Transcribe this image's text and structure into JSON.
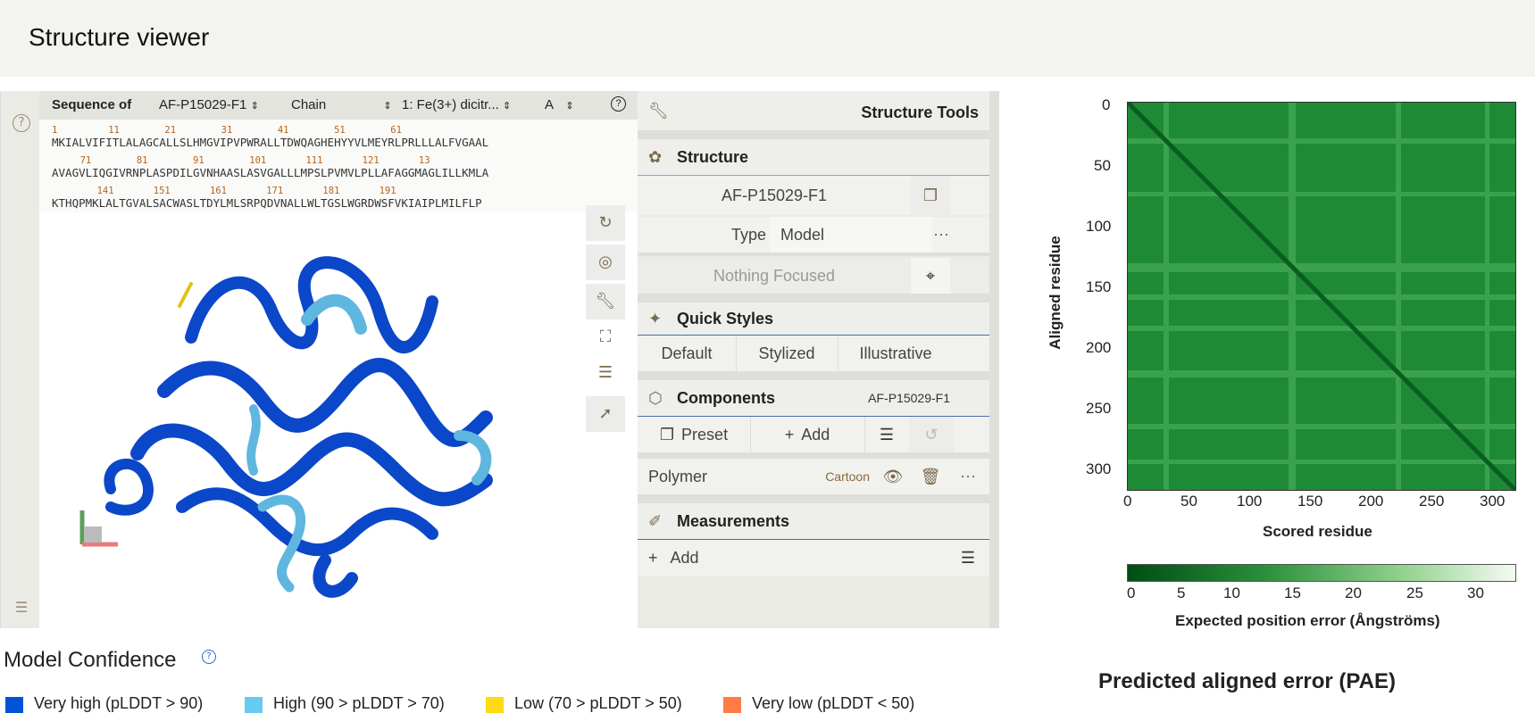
{
  "page": {
    "title": "Structure viewer"
  },
  "sequence": {
    "label": "Sequence of",
    "entry": "AF-P15029-F1",
    "mode": "Chain",
    "entity": "1: Fe(3+) dicitr...",
    "chain": "A",
    "rows": [
      {
        "numbers": "1         11        21        31        41        51        61",
        "seq": "MKIALVIFITLALAGCALLSLHMGVIPVPWRALLTDWQAGHEHYYVLMEYRLPRLLLALFVGAAL"
      },
      {
        "numbers": "     71        81        91        101       111       121       13",
        "seq": "AVAGVLIQGIVRNPLASPDILGVNHAASLASVGALLLMPSLPVMVLPLLAFAGGMAGLILLKMLA"
      },
      {
        "numbers": "        141       151       161       171       181       191",
        "seq": "KTHQPMKLALTGVALSACWASLTDYLMLSRPQDVNALLWLTGSLWGRDWSFVKIAIPLMILFLP"
      }
    ]
  },
  "tools": {
    "header": "Structure Tools",
    "structure": {
      "title": "Structure",
      "entry": "AF-P15029-F1",
      "type_label": "Type",
      "type_value": "Model",
      "focus": "Nothing Focused"
    },
    "quick_styles": {
      "title": "Quick Styles",
      "options": [
        "Default",
        "Stylized",
        "Illustrative"
      ]
    },
    "components": {
      "title": "Components",
      "entry": "AF-P15029-F1",
      "preset": "Preset",
      "add": "Add",
      "polymer": "Polymer",
      "representation": "Cartoon"
    },
    "measurements": {
      "title": "Measurements",
      "add": "Add"
    }
  },
  "pae": {
    "title": "Predicted aligned error (PAE)",
    "xlabel": "Scored residue",
    "ylabel": "Aligned residue",
    "x_ticks": [
      "0",
      "50",
      "100",
      "150",
      "200",
      "250",
      "300"
    ],
    "y_ticks": [
      "0",
      "50",
      "100",
      "150",
      "200",
      "250",
      "300"
    ],
    "colorbar_label": "Expected position error (Ångströms)",
    "colorbar_ticks": [
      "0",
      "5",
      "10",
      "15",
      "20",
      "25",
      "30"
    ]
  },
  "confidence": {
    "title": "Model Confidence",
    "legend": [
      {
        "label": "Very high (pLDDT > 90)",
        "color": "#0053d6"
      },
      {
        "label": "High (90 > pLDDT > 70)",
        "color": "#65cbf3"
      },
      {
        "label": "Low (70 > pLDDT > 50)",
        "color": "#ffdb13"
      },
      {
        "label": "Very low (pLDDT < 50)",
        "color": "#ff7d45"
      }
    ]
  }
}
